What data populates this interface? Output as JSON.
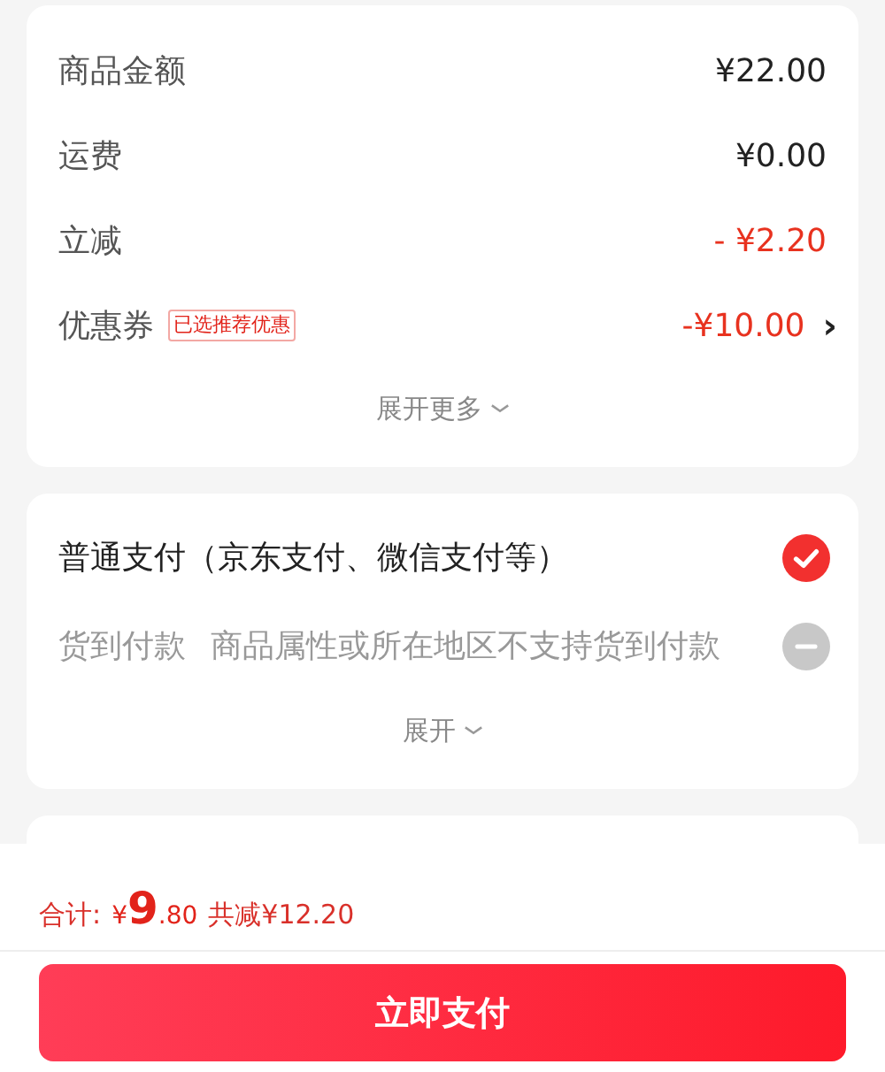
{
  "summary": {
    "rows": [
      {
        "kind": "plain",
        "label": "商品金额",
        "value": "¥22.00"
      },
      {
        "kind": "plain",
        "label": "运费",
        "value": "¥0.00"
      },
      {
        "kind": "discount",
        "label": "立减",
        "value": "- ¥2.20"
      },
      {
        "kind": "coupon",
        "label": "优惠券",
        "badge": "已选推荐优惠",
        "value": "-¥10.00",
        "chevron": "›"
      }
    ],
    "expand": "展开更多"
  },
  "payment": {
    "methods": [
      {
        "label": "普通支付（京东支付、微信支付等）",
        "selected": true,
        "disabled": false
      },
      {
        "label": "货到付款",
        "note": "商品属性或所在地区不支持货到付款",
        "selected": false,
        "disabled": true
      }
    ],
    "expand": "展开"
  },
  "footer": {
    "total_label": "合计:",
    "currency": "¥",
    "integer": "9",
    "decimal": ".80",
    "saving": "共减¥12.20",
    "button": "立即支付"
  }
}
